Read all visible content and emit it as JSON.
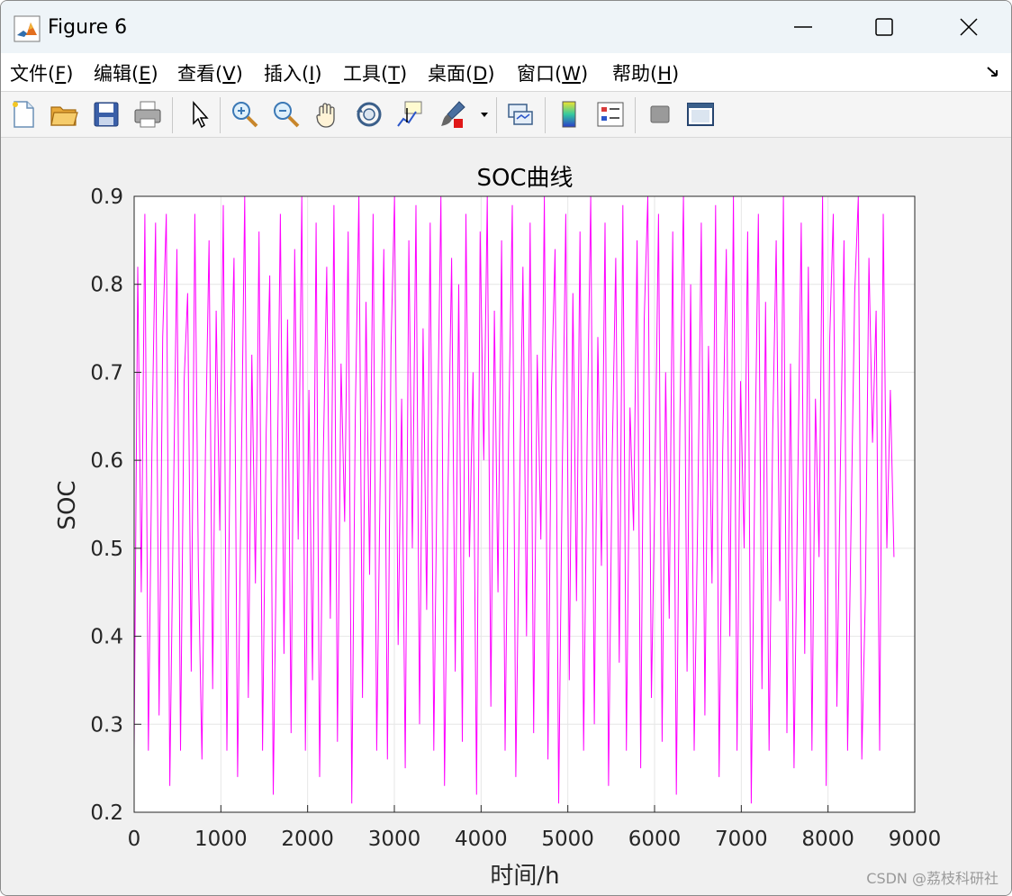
{
  "window": {
    "title": "Figure 6"
  },
  "menu": {
    "items": [
      {
        "label": "文件(",
        "key": "F",
        "suffix": ")"
      },
      {
        "label": "编辑(",
        "key": "E",
        "suffix": ")"
      },
      {
        "label": "查看(",
        "key": "V",
        "suffix": ")"
      },
      {
        "label": "插入(",
        "key": "I",
        "suffix": ")"
      },
      {
        "label": "工具(",
        "key": "T",
        "suffix": ")"
      },
      {
        "label": "桌面(",
        "key": "D",
        "suffix": ")"
      },
      {
        "label": "窗口(",
        "key": "W",
        "suffix": ")"
      },
      {
        "label": "帮助(",
        "key": "H",
        "suffix": ")"
      }
    ]
  },
  "toolbar": {
    "icons": [
      "new-figure-icon",
      "open-folder-icon",
      "save-icon",
      "print-icon",
      "pointer-icon",
      "zoom-in-icon",
      "zoom-out-icon",
      "pan-hand-icon",
      "rotate-3d-icon",
      "data-cursor-icon",
      "brush-icon",
      "brush-dropdown-icon",
      "link-plot-icon",
      "colorbar-icon",
      "legend-icon",
      "hide-plot-tools-icon",
      "show-plot-tools-icon"
    ]
  },
  "watermark": "CSDN @荔枝科研社",
  "chart_data": {
    "type": "line",
    "title": "SOC曲线",
    "xlabel": "时间/h",
    "ylabel": "SOC",
    "xlim": [
      0,
      9000
    ],
    "ylim": [
      0.2,
      0.9
    ],
    "xticks": [
      "0",
      "1000",
      "2000",
      "3000",
      "4000",
      "5000",
      "6000",
      "7000",
      "8000",
      "9000"
    ],
    "yticks": [
      "0.2",
      "0.3",
      "0.4",
      "0.5",
      "0.6",
      "0.7",
      "0.8",
      "0.9"
    ],
    "grid": true,
    "line_color": "#ff00ff",
    "series": [
      {
        "x_start": 0,
        "x_end": 8760,
        "description_range": [
          0.2,
          0.9
        ],
        "values": [
          0.27,
          0.82,
          0.45,
          0.88,
          0.27,
          0.62,
          0.87,
          0.31,
          0.74,
          0.88,
          0.23,
          0.55,
          0.84,
          0.27,
          0.69,
          0.79,
          0.36,
          0.88,
          0.48,
          0.26,
          0.61,
          0.85,
          0.34,
          0.77,
          0.52,
          0.89,
          0.27,
          0.66,
          0.83,
          0.24,
          0.58,
          0.9,
          0.33,
          0.72,
          0.46,
          0.86,
          0.27,
          0.63,
          0.81,
          0.22,
          0.54,
          0.88,
          0.38,
          0.76,
          0.29,
          0.84,
          0.51,
          0.9,
          0.27,
          0.68,
          0.35,
          0.87,
          0.24,
          0.6,
          0.82,
          0.42,
          0.89,
          0.28,
          0.71,
          0.53,
          0.86,
          0.21,
          0.65,
          0.9,
          0.33,
          0.78,
          0.47,
          0.88,
          0.27,
          0.59,
          0.84,
          0.26,
          0.73,
          0.9,
          0.39,
          0.67,
          0.25,
          0.85,
          0.5,
          0.89,
          0.3,
          0.75,
          0.43,
          0.87,
          0.27,
          0.62,
          0.9,
          0.23,
          0.57,
          0.83,
          0.36,
          0.8,
          0.28,
          0.88,
          0.49,
          0.7,
          0.22,
          0.86,
          0.6,
          0.9,
          0.32,
          0.77,
          0.45,
          0.85,
          0.27,
          0.64,
          0.89,
          0.24,
          0.55,
          0.82,
          0.4,
          0.87,
          0.29,
          0.72,
          0.51,
          0.9,
          0.26,
          0.68,
          0.84,
          0.21,
          0.58,
          0.88,
          0.35,
          0.79,
          0.44,
          0.86,
          0.27,
          0.63,
          0.9,
          0.3,
          0.74,
          0.48,
          0.87,
          0.23,
          0.6,
          0.83,
          0.37,
          0.89,
          0.27,
          0.66,
          0.52,
          0.85,
          0.25,
          0.76,
          0.9,
          0.33,
          0.57,
          0.88,
          0.28,
          0.7,
          0.42,
          0.86,
          0.22,
          0.65,
          0.9,
          0.36,
          0.8,
          0.27,
          0.54,
          0.87,
          0.31,
          0.73,
          0.46,
          0.89,
          0.24,
          0.61,
          0.84,
          0.4,
          0.9,
          0.27,
          0.69,
          0.5,
          0.86,
          0.21,
          0.59,
          0.88,
          0.34,
          0.78,
          0.27,
          0.63,
          0.85,
          0.44,
          0.9,
          0.29,
          0.71,
          0.25,
          0.56,
          0.87,
          0.38,
          0.82,
          0.27,
          0.67,
          0.49,
          0.9,
          0.23,
          0.74,
          0.88,
          0.32,
          0.6,
          0.85,
          0.27,
          0.53,
          0.79,
          0.9,
          0.26,
          0.45,
          0.83,
          0.62,
          0.77,
          0.27,
          0.88,
          0.5,
          0.68,
          0.49
        ]
      }
    ]
  }
}
